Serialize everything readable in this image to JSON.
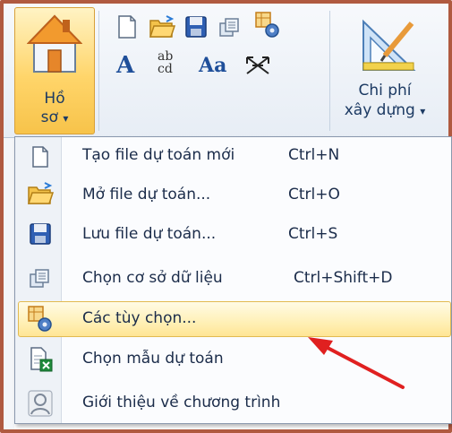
{
  "ribbon": {
    "home_button": {
      "line1": "Hồ",
      "line2": "sơ",
      "icon": "house-icon"
    },
    "toolbar_icons": [
      "new-file-icon",
      "open-folder-icon",
      "save-disk-icon",
      "database-icon",
      "options-icon"
    ],
    "format_icons": [
      "font-A-icon",
      "spacing-ab-cd-icon",
      "font-size-Aa-icon",
      "expand-arrows-icon"
    ],
    "format_glyphs": {
      "font": "A",
      "ab": "ab",
      "cd": "cd",
      "aa": "Aa"
    },
    "cost_button": {
      "line1": "Chi phí",
      "line2": "xây dựng",
      "icon": "ruler-pencil-icon"
    },
    "dropdown_arrow": "▾"
  },
  "menu": {
    "items": [
      {
        "label": "Tạo file dự toán mới",
        "shortcut": "Ctrl+N",
        "icon": "new-file-icon"
      },
      {
        "label": "Mở file dự toán...",
        "shortcut": "Ctrl+O",
        "icon": "open-folder-icon"
      },
      {
        "label": "Lưu file dự toán...",
        "shortcut": "Ctrl+S",
        "icon": "save-disk-icon"
      },
      {
        "label": "Chọn cơ sở dữ liệu",
        "shortcut": "Ctrl+Shift+D",
        "icon": "database-icon"
      },
      {
        "label": "Các tùy chọn...",
        "shortcut": "",
        "icon": "options-icon",
        "highlighted": true
      },
      {
        "label": "Chọn mẫu dự toán",
        "shortcut": "",
        "icon": "template-icon"
      },
      {
        "label": "Giới thiệu về chương trình",
        "shortcut": "",
        "icon": "user-icon"
      }
    ]
  },
  "colors": {
    "highlight": "#ffe594",
    "annotation_arrow": "#e02020",
    "frame_border": "#b05a40"
  }
}
